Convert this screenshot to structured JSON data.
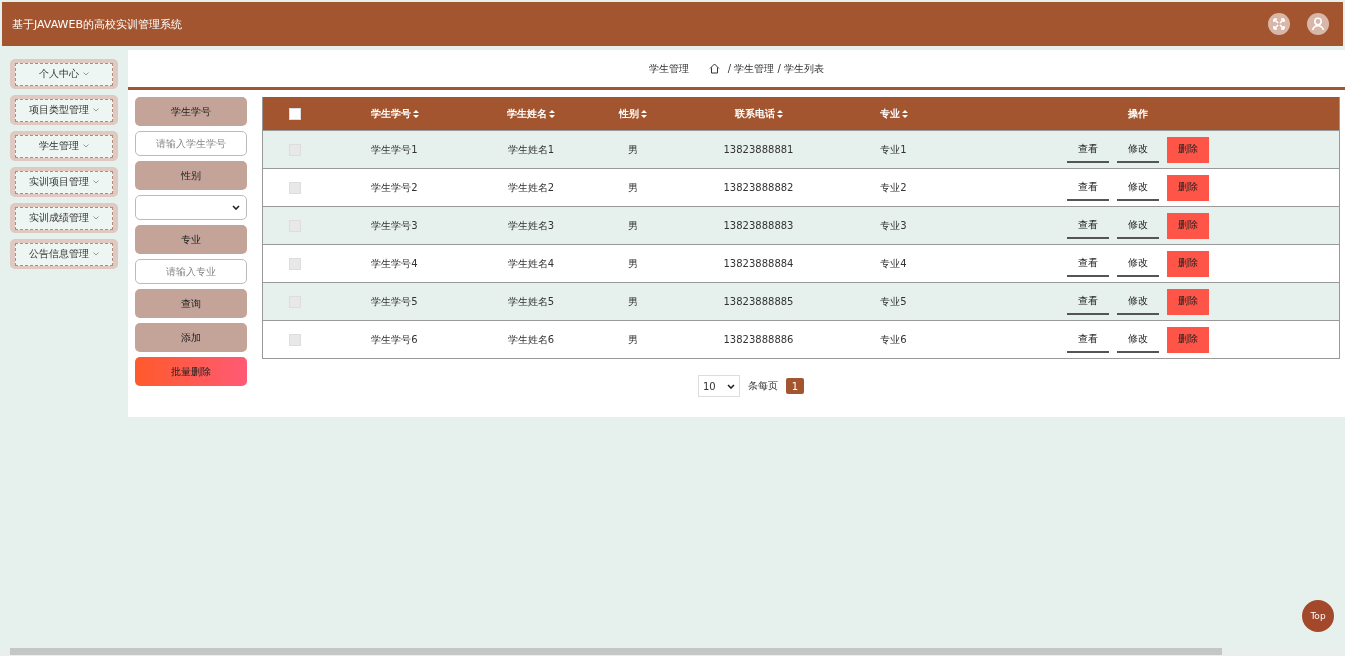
{
  "header": {
    "title": "基于JAVAWEB的高校实训管理系统"
  },
  "sidebar": {
    "items": [
      {
        "label": "个人中心",
        "expanded": false
      },
      {
        "label": "项目类型管理",
        "expanded": false
      },
      {
        "label": "学生管理",
        "expanded": false
      },
      {
        "label": "实训项目管理",
        "expanded": false
      },
      {
        "label": "实训成绩管理",
        "expanded": false
      },
      {
        "label": "公告信息管理",
        "expanded": false
      }
    ]
  },
  "breadcrumb": {
    "title": "学生管理",
    "path": "/ 学生管理 / 学生列表"
  },
  "search_panel": [
    {
      "kind": "label",
      "text": "学生学号"
    },
    {
      "kind": "input",
      "placeholder": "请输入学生学号"
    },
    {
      "kind": "label",
      "text": "性别"
    },
    {
      "kind": "select"
    },
    {
      "kind": "label",
      "text": "专业"
    },
    {
      "kind": "input",
      "placeholder": "请输入专业"
    },
    {
      "kind": "button",
      "text": "查询"
    },
    {
      "kind": "button",
      "text": "添加"
    },
    {
      "kind": "danger",
      "text": "批量删除"
    }
  ],
  "table": {
    "select_all": {
      "checked": false
    },
    "columns": [
      "学生学号",
      "学生姓名",
      "性别",
      "联系电话",
      "专业",
      "操作"
    ],
    "rows": [
      {
        "checked": false,
        "cells": [
          "学生学号1",
          "学生姓名1",
          "男",
          "13823888881",
          "专业1"
        ],
        "actions": [
          "查看",
          "修改",
          "删除"
        ]
      },
      {
        "checked": false,
        "cells": [
          "学生学号2",
          "学生姓名2",
          "男",
          "13823888882",
          "专业2"
        ],
        "actions": [
          "查看",
          "修改",
          "删除"
        ]
      },
      {
        "checked": false,
        "cells": [
          "学生学号3",
          "学生姓名3",
          "男",
          "13823888883",
          "专业3"
        ],
        "actions": [
          "查看",
          "修改",
          "删除"
        ]
      },
      {
        "checked": false,
        "cells": [
          "学生学号4",
          "学生姓名4",
          "男",
          "13823888884",
          "专业4"
        ],
        "actions": [
          "查看",
          "修改",
          "删除"
        ]
      },
      {
        "checked": false,
        "cells": [
          "学生学号5",
          "学生姓名5",
          "男",
          "13823888885",
          "专业5"
        ],
        "actions": [
          "查看",
          "修改",
          "删除"
        ]
      },
      {
        "checked": false,
        "cells": [
          "学生学号6",
          "学生姓名6",
          "男",
          "13823888886",
          "专业6"
        ],
        "actions": [
          "查看",
          "修改",
          "删除"
        ]
      }
    ]
  },
  "pagination": {
    "page_size": "10",
    "page_size_label": "条每页",
    "pages": [
      {
        "label": "1",
        "selected": true
      }
    ]
  },
  "back_to_top": {
    "label": "Top"
  }
}
